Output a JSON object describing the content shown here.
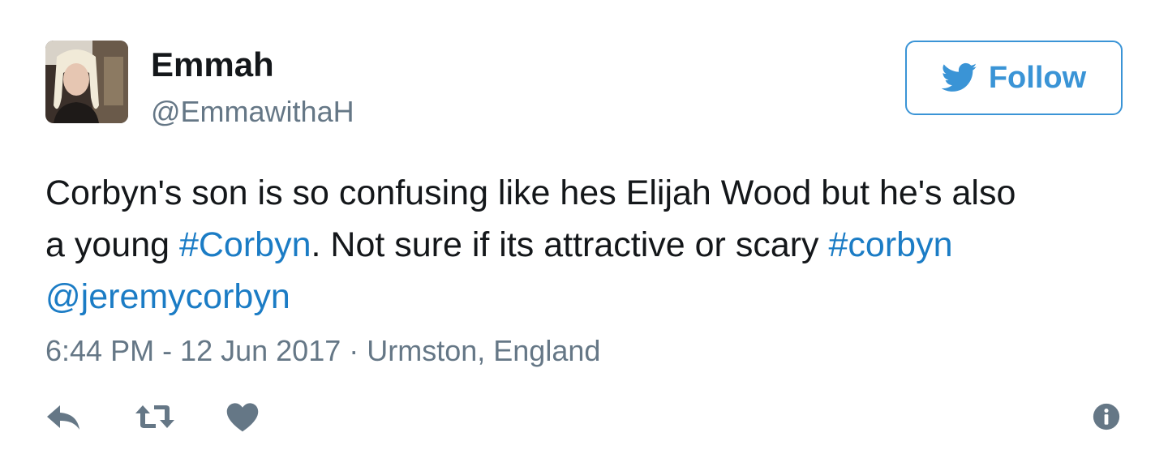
{
  "user": {
    "display_name": "Emmah",
    "handle": "@EmmawithaH",
    "avatar_icon": "user-avatar"
  },
  "follow_button": {
    "label": "Follow",
    "icon": "twitter-bird-icon",
    "accent_color": "#3a94d6"
  },
  "tweet": {
    "line1": "Corbyn's son is so confusing like hes Elijah Wood but he's also",
    "line2_prefix": "a young ",
    "hashtag1": "#Corbyn",
    "line2_middle": ". Not sure if its attractive or scary ",
    "hashtag2": "#corbyn",
    "mention": "@jeremycorbyn",
    "link_color": "#1b7cc5"
  },
  "meta": {
    "timestamp": "6:44 PM - 12 Jun 2017",
    "separator": " · ",
    "location": "Urmston, England"
  },
  "actions": {
    "reply_icon": "reply-icon",
    "retweet_icon": "retweet-icon",
    "like_icon": "heart-icon",
    "info_icon": "info-icon",
    "icon_color": "#657786"
  }
}
